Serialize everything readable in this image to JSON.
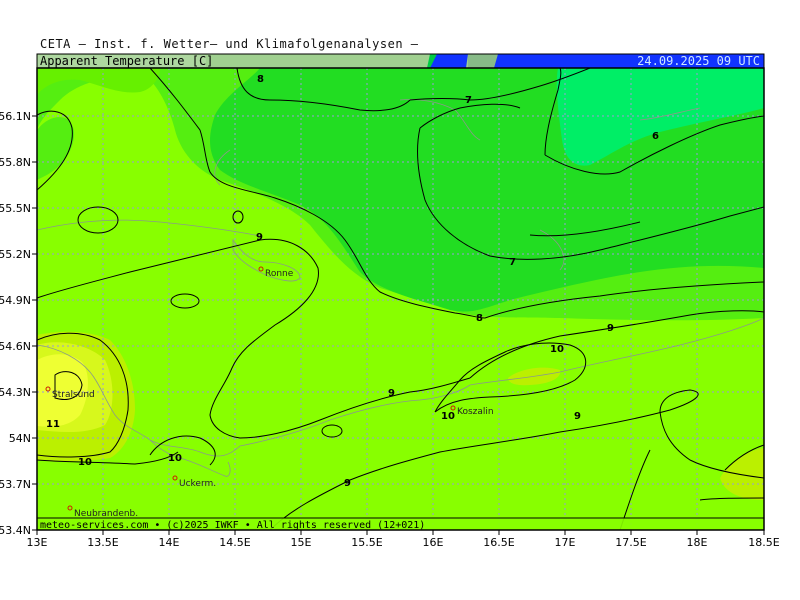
{
  "header": {
    "title": "CETA — Inst. f. Wetter— und Klimafolgenanalysen —",
    "panel_label": "Apparent Temperature [C]",
    "valid_time": "24.09.2025 09 UTC"
  },
  "footer": {
    "credit": "meteo-services.com • (c)2025 IWKF • All rights reserved (12+021)"
  },
  "axes": {
    "x_ticks": [
      "13E",
      "13.5E",
      "14E",
      "14.5E",
      "15E",
      "15.5E",
      "16E",
      "16.5E",
      "17E",
      "17.5E",
      "18E",
      "18.5E"
    ],
    "y_ticks": [
      "56.1N",
      "55.8N",
      "55.5N",
      "55.2N",
      "54.9N",
      "54.6N",
      "54.3N",
      "54N",
      "53.7N",
      "53.4N"
    ]
  },
  "cities": [
    {
      "id": "ronne",
      "name": "Ronne"
    },
    {
      "id": "stralsund",
      "name": "Stralsund"
    },
    {
      "id": "koszalin",
      "name": "Koszalin"
    },
    {
      "id": "uckerm",
      "name": "Uckerm."
    },
    {
      "id": "neubrandenb",
      "name": "Neubrandenb."
    }
  ],
  "contour_labels": [
    {
      "id": "c8a",
      "text": "8"
    },
    {
      "id": "c7a",
      "text": "7"
    },
    {
      "id": "c6",
      "text": "6"
    },
    {
      "id": "c9a",
      "text": "9"
    },
    {
      "id": "c7b",
      "text": "7"
    },
    {
      "id": "c8b",
      "text": "8"
    },
    {
      "id": "c9b",
      "text": "9"
    },
    {
      "id": "c10a",
      "text": "10"
    },
    {
      "id": "c9c",
      "text": "9"
    },
    {
      "id": "c11",
      "text": "11"
    },
    {
      "id": "c10b",
      "text": "10"
    },
    {
      "id": "c9d",
      "text": "9"
    },
    {
      "id": "c10c",
      "text": "10"
    },
    {
      "id": "c10d",
      "text": "10"
    },
    {
      "id": "c9e",
      "text": "9"
    }
  ],
  "colors": {
    "level_6": "#00ee66",
    "level_7": "#22dd22",
    "level_8": "#77ee00",
    "level_9": "#88ff00",
    "level_10": "#bbf000",
    "level_11": "#eeff33",
    "header_band": "#a0d090",
    "header_blue": "#1133ff",
    "grid": "#9a9ad8",
    "contour": "#000000"
  }
}
